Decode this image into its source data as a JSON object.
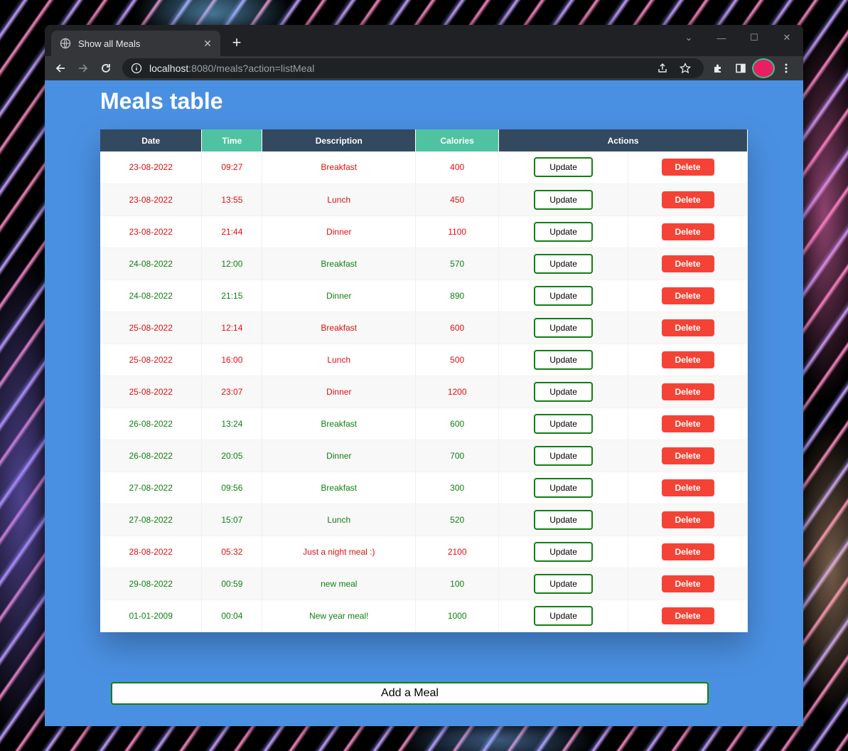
{
  "browser": {
    "tab_title": "Show all Meals",
    "url_host": "localhost",
    "url_rest": ":8080/meals?action=listMeal"
  },
  "page": {
    "title": "Meals table",
    "add_button": "Add a Meal"
  },
  "table": {
    "headers": {
      "date": "Date",
      "time": "Time",
      "description": "Description",
      "calories": "Calories",
      "actions": "Actions"
    },
    "update_label": "Update",
    "delete_label": "Delete",
    "rows": [
      {
        "date": "23-08-2022",
        "time": "09:27",
        "description": "Breakfast",
        "calories": "400",
        "status": "red"
      },
      {
        "date": "23-08-2022",
        "time": "13:55",
        "description": "Lunch",
        "calories": "450",
        "status": "red"
      },
      {
        "date": "23-08-2022",
        "time": "21:44",
        "description": "Dinner",
        "calories": "1100",
        "status": "red"
      },
      {
        "date": "24-08-2022",
        "time": "12:00",
        "description": "Breakfast",
        "calories": "570",
        "status": "green"
      },
      {
        "date": "24-08-2022",
        "time": "21:15",
        "description": "Dinner",
        "calories": "890",
        "status": "green"
      },
      {
        "date": "25-08-2022",
        "time": "12:14",
        "description": "Breakfast",
        "calories": "600",
        "status": "red"
      },
      {
        "date": "25-08-2022",
        "time": "16:00",
        "description": "Lunch",
        "calories": "500",
        "status": "red"
      },
      {
        "date": "25-08-2022",
        "time": "23:07",
        "description": "Dinner",
        "calories": "1200",
        "status": "red"
      },
      {
        "date": "26-08-2022",
        "time": "13:24",
        "description": "Breakfast",
        "calories": "600",
        "status": "green"
      },
      {
        "date": "26-08-2022",
        "time": "20:05",
        "description": "Dinner",
        "calories": "700",
        "status": "green"
      },
      {
        "date": "27-08-2022",
        "time": "09:56",
        "description": "Breakfast",
        "calories": "300",
        "status": "green"
      },
      {
        "date": "27-08-2022",
        "time": "15:07",
        "description": "Lunch",
        "calories": "520",
        "status": "green"
      },
      {
        "date": "28-08-2022",
        "time": "05:32",
        "description": "Just a night meal :)",
        "calories": "2100",
        "status": "red"
      },
      {
        "date": "29-08-2022",
        "time": "00:59",
        "description": "new meal",
        "calories": "100",
        "status": "green"
      },
      {
        "date": "01-01-2009",
        "time": "00:04",
        "description": "New year meal!",
        "calories": "1000",
        "status": "green"
      }
    ]
  },
  "colors": {
    "page_bg": "#4a90e2",
    "header_dark": "#324960",
    "header_teal": "#4fc3a1",
    "excess": "#e01010",
    "normal": "#108010",
    "delete": "#f44336"
  }
}
